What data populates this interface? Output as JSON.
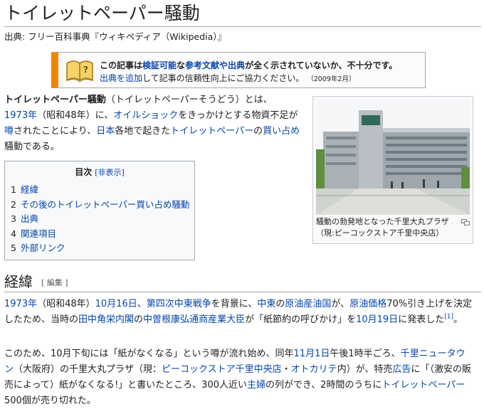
{
  "title": "トイレットペーパー騒動",
  "site_sub": "出典: フリー百科事典『ウィキペディア（Wikipedia）』",
  "ambox": {
    "l1_a": "この記事は",
    "l1_link1": "検証可能",
    "l1_b": "な",
    "l1_link2": "参考文献や出典",
    "l1_c": "が全く示されていないか、不十分です。",
    "l2_link": "出典を追加",
    "l2_text": "して記事の信頼性向上にご協力ください。",
    "l2_date": "（2009年2月）"
  },
  "lead": {
    "bold": "トイレットペーパー騒動",
    "t1": "（トイレットペーパーそうどう）とは、",
    "link_year": "1973年",
    "t2": "（昭和48年）に、",
    "link_oil": "オイルショック",
    "t3": "をきっかけとする物資不足が",
    "link_uwasa": "噂",
    "t4": "されたことにより、",
    "link_japan": "日本",
    "t5": "各地で起きた",
    "link_tp": "トイレットペーパー",
    "t6": "の",
    "link_kaishime": "買い占め",
    "t7": "騒動である。"
  },
  "toc": {
    "title": "目次",
    "hide": "[非表示]",
    "items": [
      {
        "num": "1",
        "label": "経緯"
      },
      {
        "num": "2",
        "label": "その後のトイレットペーパー買い占め騒動"
      },
      {
        "num": "3",
        "label": "出典"
      },
      {
        "num": "4",
        "label": "関連項目"
      },
      {
        "num": "5",
        "label": "外部リンク"
      }
    ]
  },
  "thumb": {
    "caption_line1": "騒動の勃発地となった千里大丸プラザ",
    "caption_line2": "（現:ピーコックストア千里中央店）"
  },
  "section": {
    "heading": "経緯",
    "edit": "[ 編集 ]"
  },
  "para1": {
    "link_year": "1973年",
    "t1": "（昭和48年）",
    "link_date": "10月16日",
    "t2": "、",
    "link_war": "第四次中東戦争",
    "t3": "を背景に、",
    "link_middleeast": "中東",
    "t4": "の",
    "link_opec": "原油産油国",
    "t5": "が、",
    "link_price": "原油価格",
    "t6": "70%引き上げを決定したため、当時の",
    "link_tanaka": "田中角栄内閣",
    "t7": "の",
    "link_nakasone": "中曽根康弘",
    "link_miti": "通商産業大臣",
    "t8": "が「紙節約の呼びかけ」を",
    "link_oct19": "10月19日",
    "t9": "に発表した",
    "ref": "[1]",
    "t10": "。"
  },
  "para2": {
    "t1": "このため、10月下旬には「紙がなくなる」という噂が流れ始め、同年",
    "link_nov1": "11月1日",
    "t2": "午後1時半ごろ、",
    "link_senri": "千里ニュータウン",
    "t3": "（大阪府）の千里大丸プラザ（現：",
    "link_peacock": "ピーコックストア千里中央店",
    "t4": "・",
    "link_okaritei": "オトカリテ",
    "t5": "内）が、特売",
    "link_ad": "広告",
    "t6": "に「（激安の販売によって）紙がなくなる!」と書いたところ、300人近い",
    "link_housewife": "主婦",
    "t7": "の列ができ、2時間のうちに",
    "link_tp": "トイレットペーパー",
    "t8": "500個が売り切れた。"
  }
}
